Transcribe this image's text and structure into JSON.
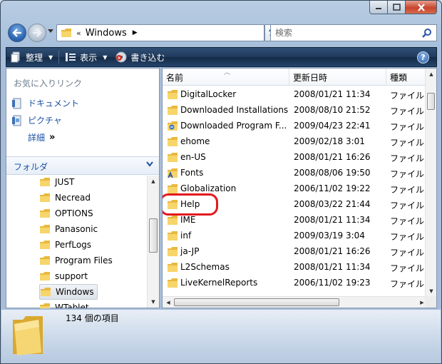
{
  "window": {
    "colors": {
      "toolbar": "#203a5c",
      "link": "#1c52a4",
      "highlight": "#e3191f",
      "folder": "#f0c95a"
    }
  },
  "address": {
    "chevron": "«",
    "crumb": "Windows",
    "search_placeholder": "検索"
  },
  "toolbar": {
    "organize_label": "整理",
    "views_label": "表示",
    "burn_label": "書き込む"
  },
  "favorites": {
    "header": "お気に入りリンク",
    "items": [
      {
        "label": "ドキュメント",
        "icon": "documents-icon"
      },
      {
        "label": "ピクチャ",
        "icon": "pictures-icon"
      }
    ],
    "more_label": "詳細",
    "more_arrow": "»"
  },
  "folders": {
    "header": "フォルダ",
    "items": [
      {
        "label": "JUST"
      },
      {
        "label": "Necread"
      },
      {
        "label": "OPTIONS"
      },
      {
        "label": "Panasonic"
      },
      {
        "label": "PerfLogs"
      },
      {
        "label": "Program Files"
      },
      {
        "label": "support"
      },
      {
        "label": "Windows",
        "selected": true
      },
      {
        "label": "WTablet"
      }
    ]
  },
  "columns": {
    "name": "名前",
    "modified": "更新日時",
    "type": "種類"
  },
  "files": [
    {
      "name": "DigitalLocker",
      "date": "2008/01/21 11:34",
      "type": "ファイル",
      "icon": "folder-icon"
    },
    {
      "name": "Downloaded Installations",
      "date": "2008/08/10 21:52",
      "type": "ファイル",
      "icon": "folder-icon"
    },
    {
      "name": "Downloaded Program F...",
      "date": "2009/04/23 22:41",
      "type": "ファイル",
      "icon": "special-folder-icon"
    },
    {
      "name": "ehome",
      "date": "2009/02/18 3:01",
      "type": "ファイル",
      "icon": "folder-icon"
    },
    {
      "name": "en-US",
      "date": "2008/01/21 16:26",
      "type": "ファイル",
      "icon": "folder-icon"
    },
    {
      "name": "Fonts",
      "date": "2008/08/06 19:50",
      "type": "ファイル",
      "icon": "fonts-folder-icon"
    },
    {
      "name": "Globalization",
      "date": "2006/11/02 19:22",
      "type": "ファイル",
      "icon": "folder-icon"
    },
    {
      "name": "Help",
      "date": "2008/03/22 21:44",
      "type": "ファイル",
      "icon": "folder-icon",
      "highlighted": true
    },
    {
      "name": "IME",
      "date": "2008/01/21 11:34",
      "type": "ファイル",
      "icon": "folder-icon"
    },
    {
      "name": "inf",
      "date": "2009/03/19 3:04",
      "type": "ファイル",
      "icon": "folder-icon"
    },
    {
      "name": "ja-JP",
      "date": "2008/01/21 16:26",
      "type": "ファイル",
      "icon": "folder-icon"
    },
    {
      "name": "L2Schemas",
      "date": "2008/01/21 11:34",
      "type": "ファイル",
      "icon": "folder-icon"
    },
    {
      "name": "LiveKernelReports",
      "date": "2006/11/02 19:23",
      "type": "ファイル",
      "icon": "folder-icon"
    }
  ],
  "details": {
    "count_text": "134 個の項目"
  }
}
